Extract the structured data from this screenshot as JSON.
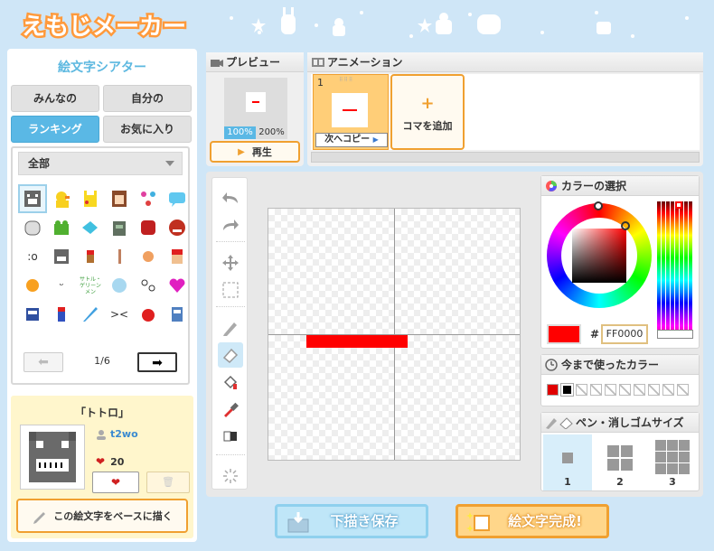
{
  "app": {
    "logo_text": "えもじメーカー"
  },
  "left": {
    "title": "絵文字シアター",
    "tabs": [
      {
        "label": "みんなの"
      },
      {
        "label": "自分の"
      },
      {
        "label": "ランキング"
      },
      {
        "label": "お気に入り"
      }
    ],
    "category": "全部",
    "pagination": {
      "page": "1/6",
      "prev": "⬅",
      "next": "➡"
    },
    "emoji_text": [
      "サトル・\nゲリーン\nメン"
    ],
    "detail": {
      "name": "「トトロ」",
      "author": "t2wo",
      "likes": "20",
      "like_heart": "❤",
      "trash": "🗑",
      "base_button": "この絵文字をベースに描く"
    }
  },
  "preview": {
    "title": "プレビュー",
    "zoom": [
      "100%",
      "200%"
    ],
    "play": "再生",
    "play_icon": "▶"
  },
  "animation": {
    "title": "アニメーション",
    "frame_number": "1",
    "copy_next": "次へコピー",
    "add_frame": "コマを追加",
    "add_icon": "+"
  },
  "color": {
    "title": "カラーの選択",
    "hex_prefix": "#",
    "hex_value": "FF0000",
    "current": "#FF0000"
  },
  "recent": {
    "title": "今まで使ったカラー"
  },
  "pensize": {
    "title": "ペン・消しゴムサイズ",
    "sizes": [
      "1",
      "2",
      "3"
    ]
  },
  "actions": {
    "save_draft": "下描き保存",
    "complete": "絵文字完成!"
  }
}
